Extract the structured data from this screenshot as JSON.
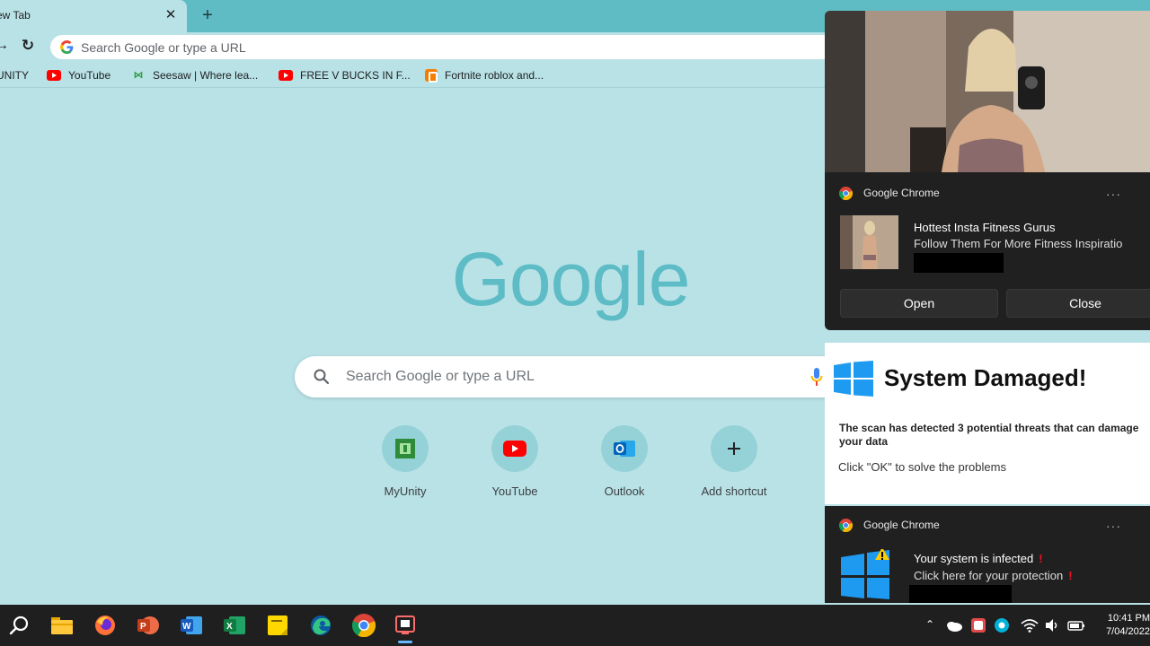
{
  "browser": {
    "tab_title": "ew Tab",
    "tab_close": "✕",
    "new_tab": "+",
    "omnibox_placeholder": "Search Google or type a URL"
  },
  "bookmarks": [
    {
      "label": "UNITY",
      "icon": "unity-icon"
    },
    {
      "label": "YouTube",
      "icon": "youtube-icon"
    },
    {
      "label": "Seesaw | Where lea...",
      "icon": "seesaw-icon"
    },
    {
      "label": "FREE V BUCKS IN F...",
      "icon": "youtube-icon"
    },
    {
      "label": "Fortnite roblox and...",
      "icon": "blogger-icon"
    }
  ],
  "ntp": {
    "logo_text": "Google",
    "search_placeholder": "Search Google or type a URL",
    "shortcuts": [
      {
        "label": "MyUnity",
        "icon": "myunity-icon"
      },
      {
        "label": "YouTube",
        "icon": "youtube-icon"
      },
      {
        "label": "Outlook",
        "icon": "outlook-icon"
      },
      {
        "label": "Add shortcut",
        "icon": "plus-icon"
      }
    ]
  },
  "notification_fitness": {
    "app": "Google Chrome",
    "menu": "···",
    "title": "Hottest Insta Fitness Gurus",
    "body": "Follow Them For More Fitness Inspiratio",
    "open_label": "Open",
    "close_label": "Close"
  },
  "system_damaged": {
    "title": "System Damaged!",
    "body": "The scan has detected 3 potential threats that can damage your data",
    "cta": "Click \"OK\" to solve the problems"
  },
  "notification_infected": {
    "app": "Google Chrome",
    "menu": "···",
    "title": "Your system is infected",
    "body": "Click here for your protection",
    "mark": "!"
  },
  "taskbar": {
    "time": "10:41 PM",
    "date": "7/04/2022"
  },
  "colors": {
    "page_bg": "#b9e2e6",
    "tabstrip": "#5fbcc4",
    "logo": "#5ebcc6",
    "notification_bg": "#202020",
    "taskbar_bg": "#1f1f1f",
    "alert_red": "#e81123",
    "windows_blue": "#1e9bf0"
  }
}
